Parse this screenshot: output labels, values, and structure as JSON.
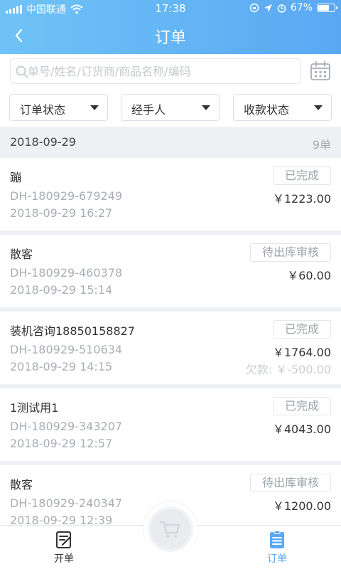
{
  "status": {
    "carrier": "中国联通",
    "time": "17:38",
    "battery": "67%"
  },
  "nav": {
    "title": "订单"
  },
  "search": {
    "placeholder": "单号/姓名/订货商/商品名称/编码"
  },
  "filters": [
    "订单状态",
    "经手人",
    "收款状态"
  ],
  "group": {
    "date": "2018-09-29",
    "count": "9单"
  },
  "orders": [
    {
      "name": "蹦",
      "no": "DH-180929-679249",
      "time": "2018-09-29 16:27",
      "status": "已完成",
      "amount": "￥1223.00",
      "debt": ""
    },
    {
      "name": "散客",
      "no": "DH-180929-460378",
      "time": "2018-09-29 15:14",
      "status": "待出库审核",
      "amount": "￥60.00",
      "debt": ""
    },
    {
      "name": "装机咨询18850158827",
      "no": "DH-180929-510634",
      "time": "2018-09-29 14:15",
      "status": "已完成",
      "amount": "￥1764.00",
      "debt": "欠款: ￥-500.00"
    },
    {
      "name": "1测试用1",
      "no": "DH-180929-343207",
      "time": "2018-09-29 12:57",
      "status": "已完成",
      "amount": "￥4043.00",
      "debt": ""
    },
    {
      "name": "散客",
      "no": "DH-180929-240347",
      "time": "2018-09-29 12:39",
      "status": "待出库审核",
      "amount": "￥1200.00",
      "debt": ""
    }
  ],
  "tabs": {
    "open": "开单",
    "orders": "订单"
  },
  "icons": {
    "back": "chevron-left-icon",
    "search": "search-icon",
    "calendar": "calendar-icon",
    "cart": "cart-icon",
    "open": "edit-icon",
    "orders": "list-icon"
  },
  "colors": {
    "accent": "#5aa8f3",
    "header_start": "#6fc3f7"
  }
}
